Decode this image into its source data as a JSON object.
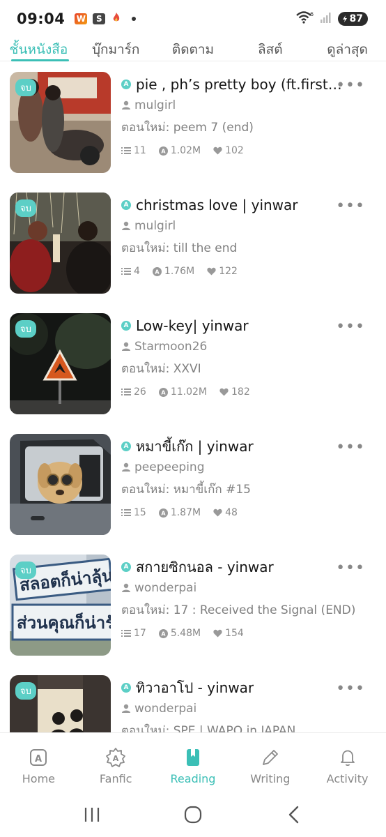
{
  "status_bar": {
    "time": "09:04",
    "battery": "87",
    "wifi_label": "6"
  },
  "tabs": [
    {
      "label": "ชั้นหนังสือ",
      "active": true
    },
    {
      "label": "บุ๊กมาร์ก",
      "active": false
    },
    {
      "label": "ติดตาม",
      "active": false
    },
    {
      "label": "ลิสต์",
      "active": false
    },
    {
      "label": "ดูล่าสุด",
      "active": false
    }
  ],
  "stories": [
    {
      "badge": "จบ",
      "title": "pie , ph’s pretty boy (ft.first ...",
      "author": "mulgirl",
      "update": "ตอนใหม่: peem 7 (end)",
      "chapters": "11",
      "views": "1.02M",
      "likes": "102"
    },
    {
      "badge": "จบ",
      "title": "christmas love | yinwar",
      "author": "mulgirl",
      "update": "ตอนใหม่: till the end",
      "chapters": "4",
      "views": "1.76M",
      "likes": "122"
    },
    {
      "badge": "จบ",
      "title": "Low-key| yinwar",
      "author": "Starmoon26",
      "update": "ตอนใหม่: XXVI",
      "chapters": "26",
      "views": "11.02M",
      "likes": "182"
    },
    {
      "badge": "",
      "title": "หมาขี้เก๊ก | yinwar",
      "author": "peepeeping",
      "update": "ตอนใหม่: หมาขี้เก๊ก #15",
      "chapters": "15",
      "views": "1.87M",
      "likes": "48"
    },
    {
      "badge": "จบ",
      "title": "สกายซิกนอล - yinwar",
      "author": "wonderpai",
      "update": "ตอนใหม่: 17 : Received the Signal (END)",
      "chapters": "17",
      "views": "5.48M",
      "likes": "154"
    },
    {
      "badge": "จบ",
      "title": "ทิวาอาโป - yinwar",
      "author": "wonderpai",
      "update": "ตอนใหม่: SPE | WAPO in JAPAN",
      "chapters": "",
      "views": "",
      "likes": ""
    }
  ],
  "cover_sign_text": {
    "line1": "สลอตก็น่าลุ้น",
    "line2": "ส่วนคุณก็น่ารัก"
  },
  "bottom_nav": [
    {
      "label": "Home",
      "icon": "home-icon",
      "active": false
    },
    {
      "label": "Fanfic",
      "icon": "fanfic-icon",
      "active": false
    },
    {
      "label": "Reading",
      "icon": "reading-icon",
      "active": true
    },
    {
      "label": "Writing",
      "icon": "pencil-icon",
      "active": false
    },
    {
      "label": "Activity",
      "icon": "bell-icon",
      "active": false
    }
  ],
  "colors": {
    "accent": "#3bbfb6",
    "badge": "#5ccfc6"
  }
}
